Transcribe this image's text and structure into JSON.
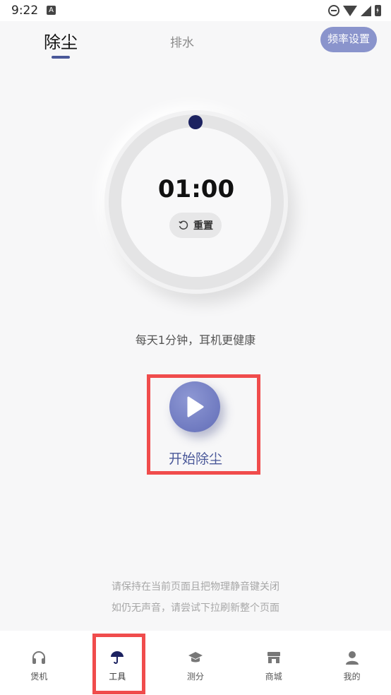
{
  "status_bar": {
    "time": "9:22",
    "notification_icon": "A"
  },
  "header": {
    "tab_active": "除尘",
    "tab_other": "排水",
    "freq_button": "频率设置"
  },
  "dial": {
    "timer": "01:00",
    "reset_label": "重置"
  },
  "tip": "每天1分钟，耳机更健康",
  "start": {
    "label": "开始除尘"
  },
  "hints": {
    "line1": "请保持在当前页面且把物理静音键关闭",
    "line2": "如仍无声音，请尝试下拉刷新整个页面"
  },
  "nav": {
    "items": [
      {
        "label": "煲机",
        "icon": "headphones-icon"
      },
      {
        "label": "工具",
        "icon": "umbrella-icon"
      },
      {
        "label": "测分",
        "icon": "graduation-cap-icon"
      },
      {
        "label": "商城",
        "icon": "store-icon"
      },
      {
        "label": "我的",
        "icon": "person-icon"
      }
    ],
    "active_index": 1
  },
  "colors": {
    "accent": "#4a5899",
    "button_fill": "#8a94cc",
    "highlight_box": "#f04c4c",
    "knob": "#1c2260"
  }
}
